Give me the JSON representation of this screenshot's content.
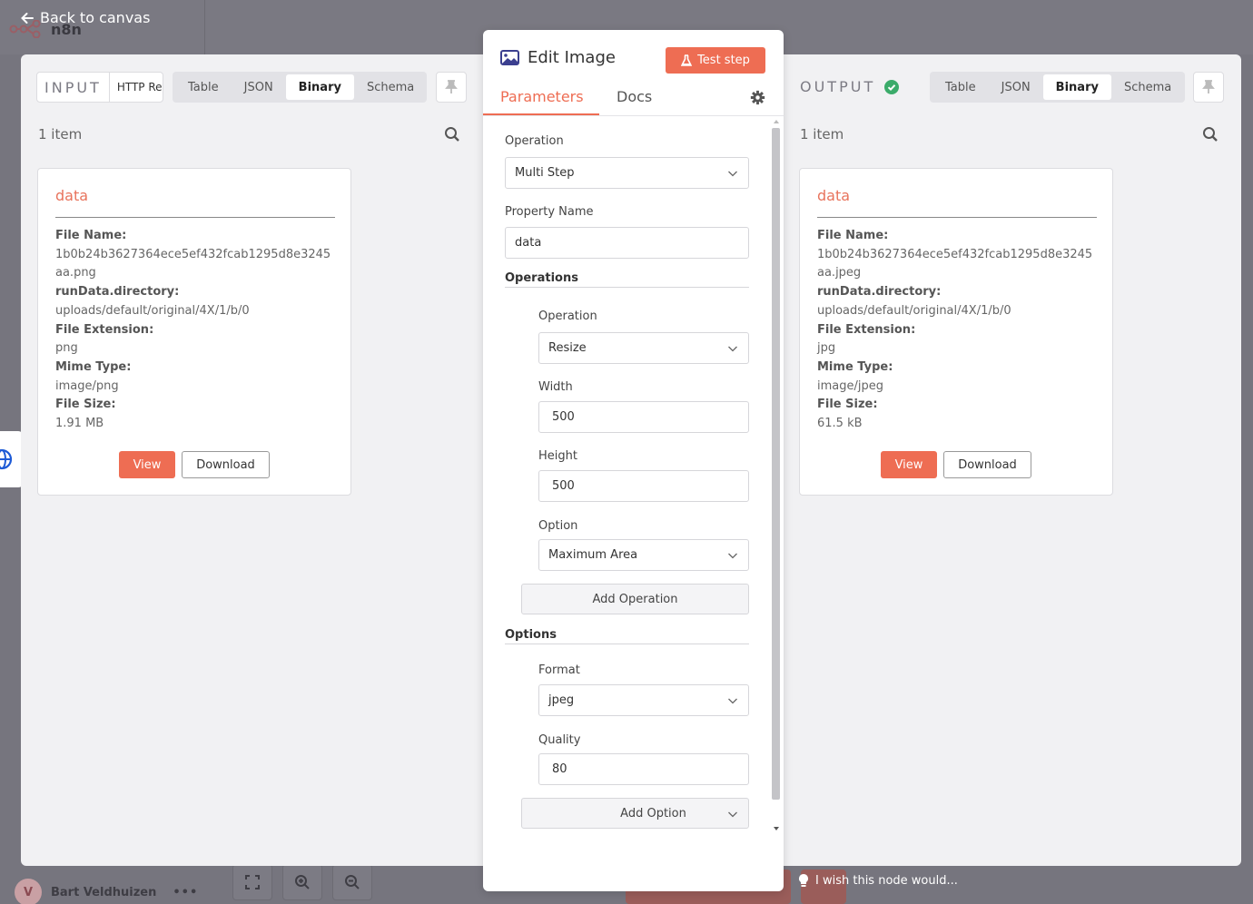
{
  "app": {
    "back_label": "Back to canvas",
    "logo_text": "n8n"
  },
  "user": {
    "initial": "V",
    "name": "Bart Veldhuizen",
    "more": "•••"
  },
  "feedback": {
    "wish_text": "I wish this node would..."
  },
  "input": {
    "label": "INPUT",
    "source": "HTTP Request",
    "views": [
      "Table",
      "JSON",
      "Binary",
      "Schema"
    ],
    "active_view": "Binary",
    "count": "1 item",
    "card": {
      "title": "data",
      "fields": [
        {
          "key": "File Name:",
          "value": "1b0b24b3627364ece5ef432fcab1295d8e3245aa.png"
        },
        {
          "key": "runData.directory:",
          "value": "uploads/default/original/4X/1/b/0"
        },
        {
          "key": "File Extension:",
          "value": "png"
        },
        {
          "key": "Mime Type:",
          "value": "image/png"
        },
        {
          "key": "File Size:",
          "value": "1.91 MB"
        }
      ],
      "view_label": "View",
      "download_label": "Download"
    }
  },
  "output": {
    "label": "OUTPUT",
    "views": [
      "Table",
      "JSON",
      "Binary",
      "Schema"
    ],
    "active_view": "Binary",
    "count": "1 item",
    "status_color": "#3bab6a",
    "card": {
      "title": "data",
      "fields": [
        {
          "key": "File Name:",
          "value": "1b0b24b3627364ece5ef432fcab1295d8e3245aa.jpeg"
        },
        {
          "key": "runData.directory:",
          "value": "uploads/default/original/4X/1/b/0"
        },
        {
          "key": "File Extension:",
          "value": "jpg"
        },
        {
          "key": "Mime Type:",
          "value": "image/jpeg"
        },
        {
          "key": "File Size:",
          "value": "61.5 kB"
        }
      ],
      "view_label": "View",
      "download_label": "Download"
    }
  },
  "editor": {
    "title": "Edit Image",
    "test_label": "Test step",
    "tabs": [
      "Parameters",
      "Docs"
    ],
    "active_tab": "Parameters",
    "operation_label": "Operation",
    "operation_value": "Multi Step",
    "property_label": "Property Name",
    "property_value": "data",
    "operations_section": "Operations",
    "sub_operation_label": "Operation",
    "sub_operation_value": "Resize",
    "width_label": "Width",
    "width_value": "500",
    "height_label": "Height",
    "height_value": "500",
    "option_label": "Option",
    "option_value": "Maximum Area",
    "add_operation_label": "Add Operation",
    "options_section": "Options",
    "format_label": "Format",
    "format_value": "jpeg",
    "quality_label": "Quality",
    "quality_value": "80",
    "add_option_label": "Add Option"
  },
  "colors": {
    "accent": "#ee6d53",
    "modal_bg": "#f1f1f3",
    "backdrop": "#76757e"
  }
}
